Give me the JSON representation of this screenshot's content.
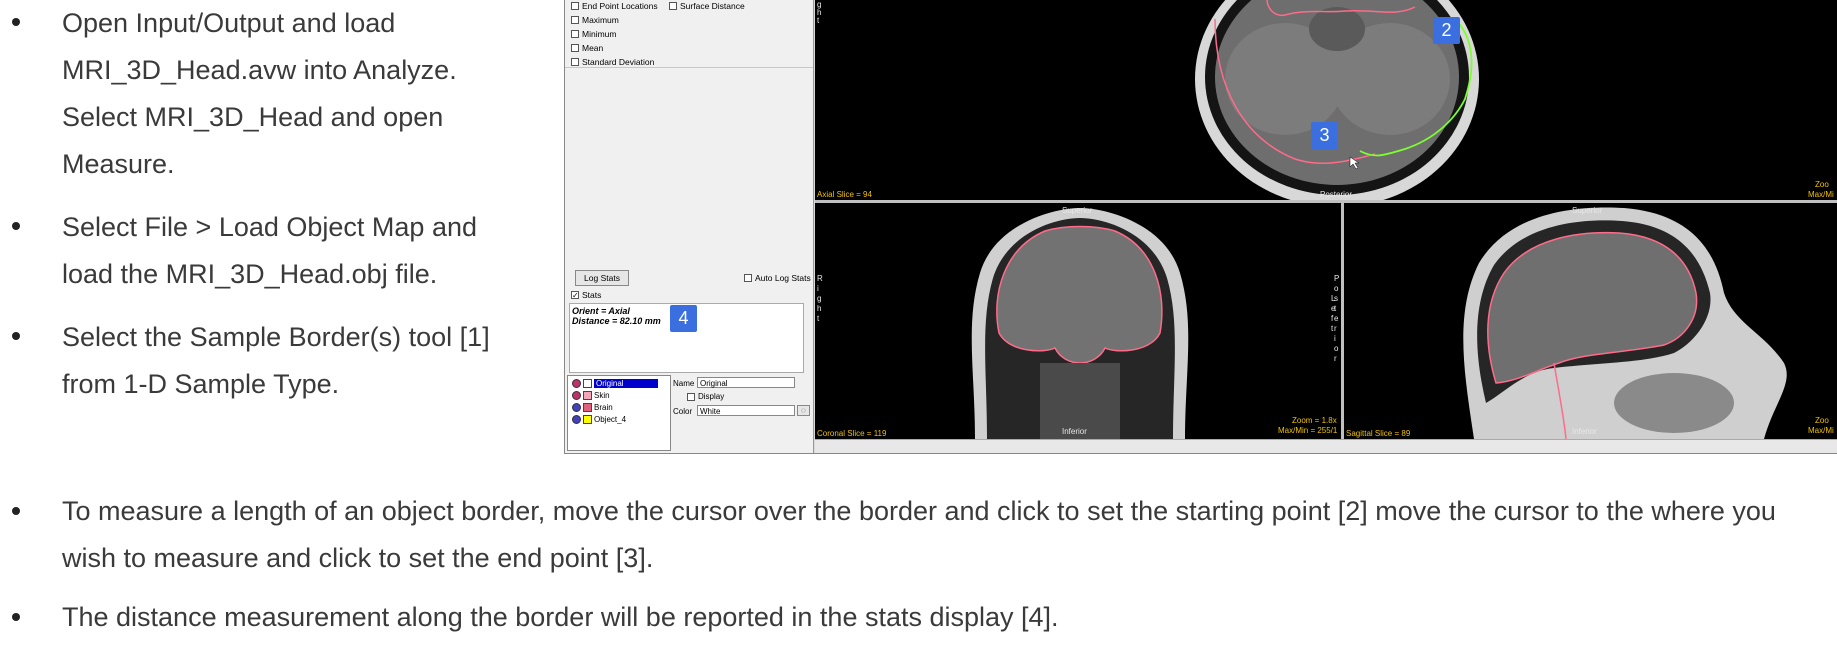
{
  "instructions_top": [
    "Open Input/Output and load MRI_3D_Head.avw into Analyze. Select MRI_3D_Head and open Measure.",
    "Select File > Load Object Map and load the MRI_3D_Head.obj file.",
    "Select the Sample Border(s) tool [1] from 1-D Sample Type."
  ],
  "instructions_bottom": [
    "To measure a length of an object border, move the cursor over the border and click to set the starting point [2] move the cursor to the where you wish to measure and click to set the end point [3].",
    "The distance measurement along the border will be reported in the stats display [4]."
  ],
  "measure_panel": {
    "stat_options": [
      "End Point Locations",
      "Surface Distance",
      "Maximum",
      "Minimum",
      "Mean",
      "Standard Deviation"
    ],
    "log_stats_button": "Log Stats",
    "auto_log_stats_label": "Auto Log Stats",
    "stats_label": "Stats",
    "stats_text": [
      "Orient = Axial",
      "Distance = 82.10 mm"
    ],
    "objects": [
      {
        "name": "Original",
        "color": "#ffffff",
        "selected": true
      },
      {
        "name": "Skin",
        "color": "#f4a6b8",
        "selected": false
      },
      {
        "name": "Brain",
        "color": "#e0607e",
        "selected": false
      },
      {
        "name": "Object_4",
        "color": "#ffff00",
        "selected": false
      }
    ],
    "name_label": "Name",
    "name_value": "Original",
    "display_label": "Display",
    "color_label": "Color",
    "color_value": "White"
  },
  "image_labels": {
    "axial_slice": "Axial Slice = 94",
    "axial_posterior": "Posterior",
    "axial_zoom": "Zoo",
    "axial_maxmin": "Max/Mi",
    "axial_right": "g h t",
    "coronal_superior": "Superior",
    "coronal_inferior": "Inferior",
    "coronal_slice": "Coronal Slice = 119",
    "coronal_zoom": "Zoom = 1.8x",
    "coronal_maxmin": "Max/Min = 255/1",
    "coronal_right": "R i g h t",
    "coronal_left": "L e f t",
    "sagittal_superior": "Superior",
    "sagittal_inferior": "Inferior",
    "sagittal_slice": "Sagittal Slice = 89",
    "sagittal_zoom": "Zoo",
    "sagittal_maxmin": "Max/Mi",
    "sagittal_posterior": "P o s t e r i o r"
  },
  "callouts": {
    "c2": "2",
    "c3": "3",
    "c4": "4"
  },
  "colors": {
    "callout": "#3b6fe0",
    "brain_border": "#ff6b8a",
    "trace": "#7cff2e",
    "overlay_text": "#f0c000"
  }
}
